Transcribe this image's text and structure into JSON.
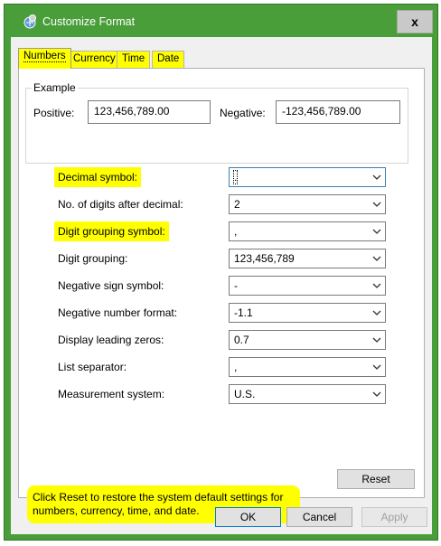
{
  "window": {
    "title": "Customize Format",
    "close_label": "x"
  },
  "tabs": [
    {
      "label": "Numbers",
      "active": true
    },
    {
      "label": "Currency",
      "active": false
    },
    {
      "label": "Time",
      "active": false
    },
    {
      "label": "Date",
      "active": false
    }
  ],
  "example": {
    "legend": "Example",
    "positive_label": "Positive:",
    "positive_value": "123,456,789.00",
    "negative_label": "Negative:",
    "negative_value": "-123,456,789.00"
  },
  "settings": [
    {
      "label": "Decimal symbol:",
      "value": ".",
      "highlighted": true
    },
    {
      "label": "No. of digits after decimal:",
      "value": "2",
      "highlighted": false
    },
    {
      "label": "Digit grouping symbol:",
      "value": ",",
      "highlighted": true
    },
    {
      "label": "Digit grouping:",
      "value": "123,456,789",
      "highlighted": false
    },
    {
      "label": "Negative sign symbol:",
      "value": "-",
      "highlighted": false
    },
    {
      "label": "Negative number format:",
      "value": "-1.1",
      "highlighted": false
    },
    {
      "label": "Display leading zeros:",
      "value": "0.7",
      "highlighted": false
    },
    {
      "label": "List separator:",
      "value": ",",
      "highlighted": false
    },
    {
      "label": "Measurement system:",
      "value": "U.S.",
      "highlighted": false
    }
  ],
  "note": "Click Reset to restore the system default settings for numbers, currency, time, and date.",
  "buttons": {
    "reset": "Reset",
    "ok": "OK",
    "cancel": "Cancel",
    "apply": "Apply"
  },
  "colors": {
    "titlebar": "#4a9e3a",
    "highlight": "#ffff00",
    "default_button_border": "#0078d7"
  }
}
